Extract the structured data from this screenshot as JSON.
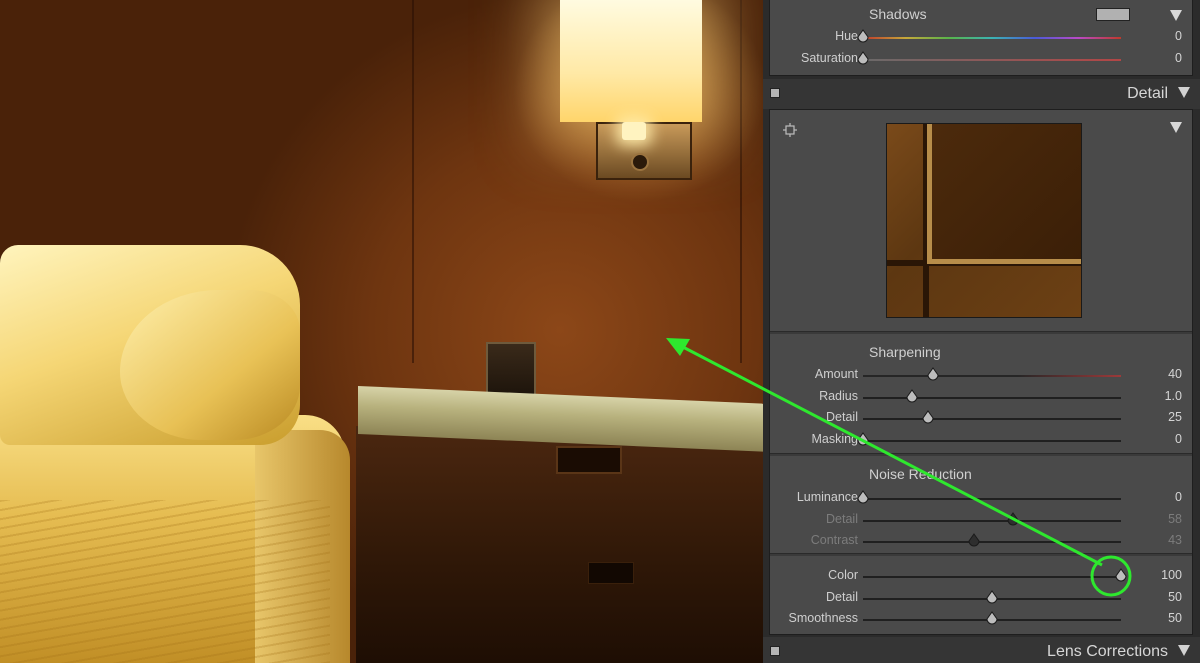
{
  "panels": {
    "hsl_shadows": {
      "title": "Shadows",
      "swatch_color": "#b1b1b1",
      "sliders": [
        {
          "label": "Hue",
          "value": "0",
          "fraction": 0.0
        },
        {
          "label": "Saturation",
          "value": "0",
          "fraction": 0.0
        }
      ]
    },
    "detail": {
      "header": "Detail",
      "sharpening": {
        "title": "Sharpening",
        "sliders": [
          {
            "label": "Amount",
            "value": "40",
            "fraction": 0.27
          },
          {
            "label": "Radius",
            "value": "1.0",
            "fraction": 0.19
          },
          {
            "label": "Detail",
            "value": "25",
            "fraction": 0.25
          },
          {
            "label": "Masking",
            "value": "0",
            "fraction": 0.0
          }
        ]
      },
      "noise_reduction": {
        "title": "Noise Reduction",
        "luminance_sliders": [
          {
            "label": "Luminance",
            "value": "0",
            "fraction": 0.0,
            "dim": false
          },
          {
            "label": "Detail",
            "value": "58",
            "fraction": 0.58,
            "dim": true
          },
          {
            "label": "Contrast",
            "value": "43",
            "fraction": 0.43,
            "dim": true
          }
        ],
        "color_sliders": [
          {
            "label": "Color",
            "value": "100",
            "fraction": 1.0
          },
          {
            "label": "Detail",
            "value": "50",
            "fraction": 0.5
          },
          {
            "label": "Smoothness",
            "value": "50",
            "fraction": 0.5
          }
        ]
      }
    },
    "lens_corrections": {
      "header": "Lens Corrections"
    }
  },
  "annotation": {
    "arrow_color": "#2ee82e",
    "circle_color": "#2ee82e"
  },
  "icons": {
    "collapse": "triangle-down-icon",
    "target": "crosshair-target-icon",
    "panel_toggle": "panel-switch-icon"
  }
}
